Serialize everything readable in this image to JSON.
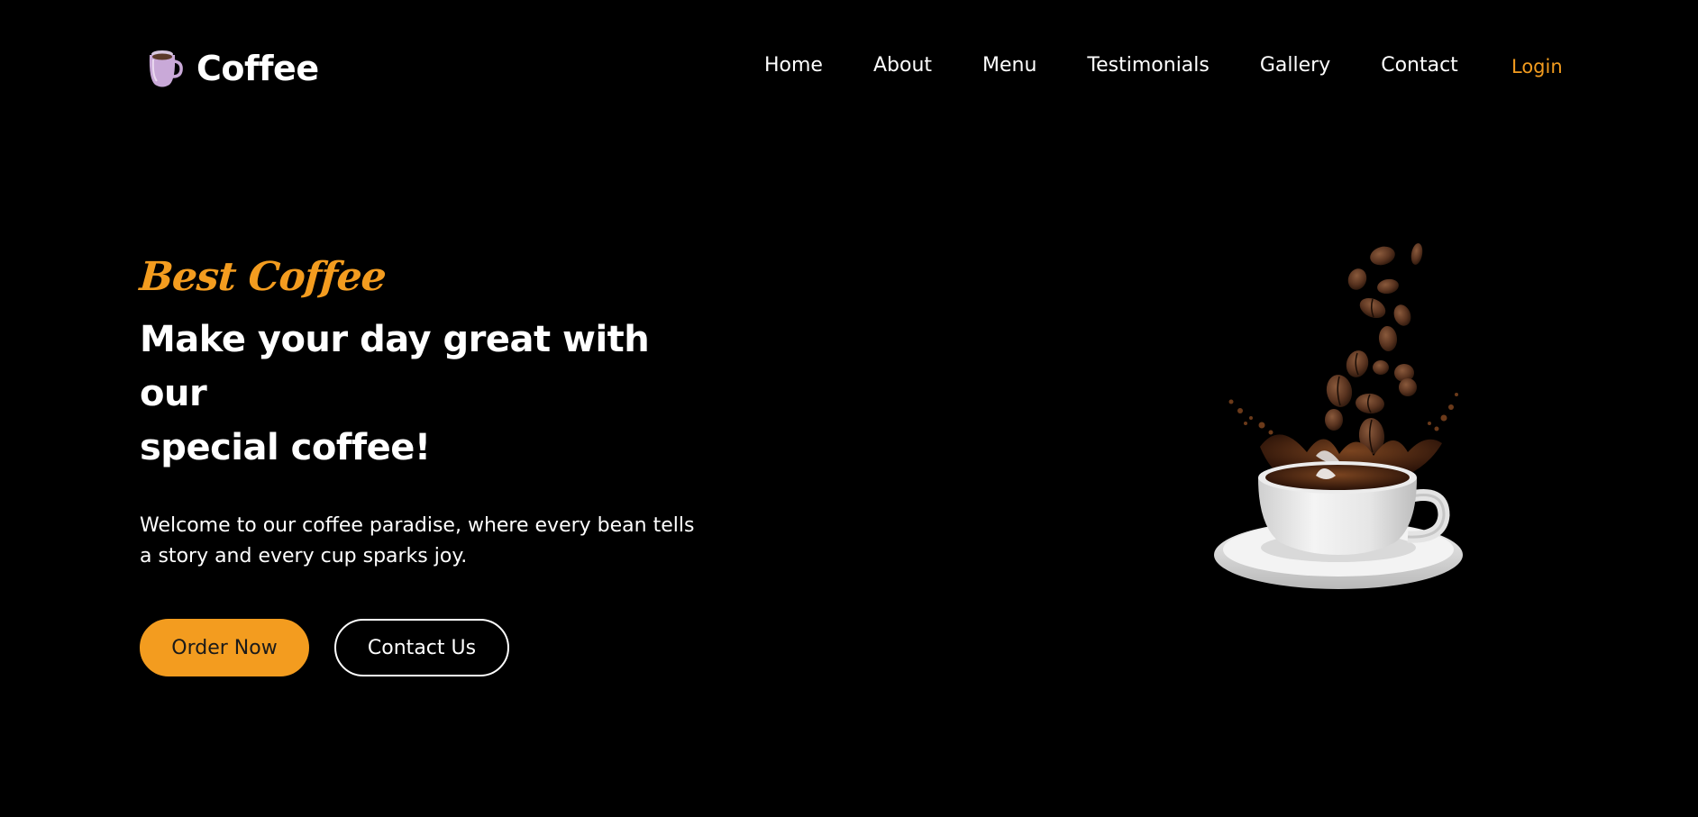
{
  "brand": {
    "name": "Coffee",
    "logo_icon": "coffee-mug-icon"
  },
  "nav": {
    "links": [
      "Home",
      "About",
      "Menu",
      "Testimonials",
      "Gallery",
      "Contact"
    ],
    "login": "Login"
  },
  "hero": {
    "subtitle": "Best Coffee",
    "headline_line1": "Make your day great with our",
    "headline_line2": "special coffee!",
    "description_line1": "Welcome to our coffee paradise, where every bean tells",
    "description_line2": "a story and every cup sparks joy.",
    "primary_button": "Order Now",
    "secondary_button": "Contact Us",
    "image_icon": "coffee-cup-splash-image"
  },
  "colors": {
    "background": "#000000",
    "accent": "#f39c1f",
    "text": "#ffffff"
  }
}
